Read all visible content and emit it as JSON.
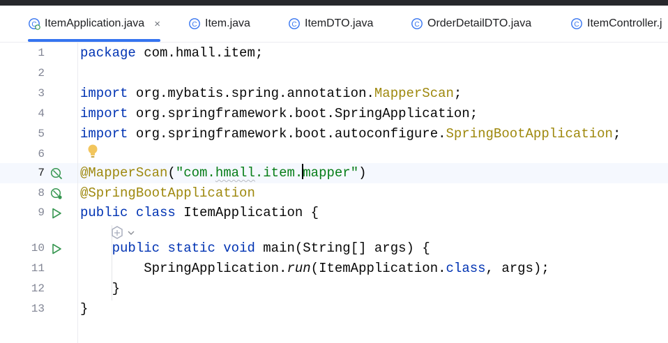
{
  "tabs": [
    {
      "label": "ItemApplication.java",
      "active": true,
      "close_glyph": "×",
      "icon": "spring-boot-class-icon"
    },
    {
      "label": "Item.java",
      "icon": "class-icon"
    },
    {
      "label": "ItemDTO.java",
      "icon": "class-icon"
    },
    {
      "label": "OrderDetailDTO.java",
      "icon": "class-icon"
    },
    {
      "label": "ItemController.j",
      "icon": "class-icon"
    }
  ],
  "editor": {
    "current_line": 7,
    "lines": [
      {
        "n": "1",
        "tokens": [
          {
            "t": "package",
            "c": "kw"
          },
          {
            "t": " com.hmall.item;"
          }
        ]
      },
      {
        "n": "2",
        "tokens": []
      },
      {
        "n": "3",
        "tokens": [
          {
            "t": "import",
            "c": "kw"
          },
          {
            "t": " org.mybatis.spring.annotation."
          },
          {
            "t": "MapperScan",
            "c": "ann"
          },
          {
            "t": ";"
          }
        ]
      },
      {
        "n": "4",
        "tokens": [
          {
            "t": "import",
            "c": "kw"
          },
          {
            "t": " org.springframework.boot.SpringApplication;"
          }
        ]
      },
      {
        "n": "5",
        "tokens": [
          {
            "t": "import",
            "c": "kw"
          },
          {
            "t": " org.springframework.boot.autoconfigure."
          },
          {
            "t": "SpringBootApplication",
            "c": "ann"
          },
          {
            "t": ";"
          }
        ]
      },
      {
        "n": "6",
        "tokens": []
      },
      {
        "n": "7",
        "icon": "mapper-scan-gutter-icon",
        "tokens": [
          {
            "t": "@MapperScan",
            "c": "ann"
          },
          {
            "t": "("
          },
          {
            "t": "\"com.",
            "c": "str"
          },
          {
            "t": "hmall",
            "c": "str squig"
          },
          {
            "t": ".item.",
            "c": "str"
          },
          {
            "t": "|",
            "c": "caret"
          },
          {
            "t": "mapper",
            "c": "str"
          },
          {
            "t": "\"",
            "c": "str"
          },
          {
            "t": ")"
          }
        ]
      },
      {
        "n": "8",
        "icon": "spring-bean-gutter-icon",
        "tokens": [
          {
            "t": "@SpringBootApplication",
            "c": "ann"
          }
        ]
      },
      {
        "n": "9",
        "icon": "run-gutter-icon",
        "tokens": [
          {
            "t": "public",
            "c": "kw"
          },
          {
            "t": " "
          },
          {
            "t": "class",
            "c": "kw"
          },
          {
            "t": " ItemApplication {"
          }
        ]
      },
      {
        "n": "",
        "tokens": []
      },
      {
        "n": "10",
        "icon": "run-gutter-icon",
        "tokens": [
          {
            "t": "    "
          },
          {
            "t": "public",
            "c": "kw"
          },
          {
            "t": " "
          },
          {
            "t": "static",
            "c": "kw"
          },
          {
            "t": " "
          },
          {
            "t": "void",
            "c": "kw"
          },
          {
            "t": " main(String[] args) {"
          }
        ]
      },
      {
        "n": "11",
        "tokens": [
          {
            "t": "        SpringApplication."
          },
          {
            "t": "run",
            "c": "ital"
          },
          {
            "t": "(ItemApplication."
          },
          {
            "t": "class",
            "c": "kw"
          },
          {
            "t": ", args);"
          }
        ]
      },
      {
        "n": "12",
        "tokens": [
          {
            "t": "    }"
          }
        ]
      },
      {
        "n": "13",
        "tokens": [
          {
            "t": "}"
          }
        ]
      }
    ]
  },
  "colors": {
    "keyword": "#0033b3",
    "annotation": "#9e880d",
    "string": "#067d17",
    "accent": "#3574f0",
    "run": "#369650"
  }
}
